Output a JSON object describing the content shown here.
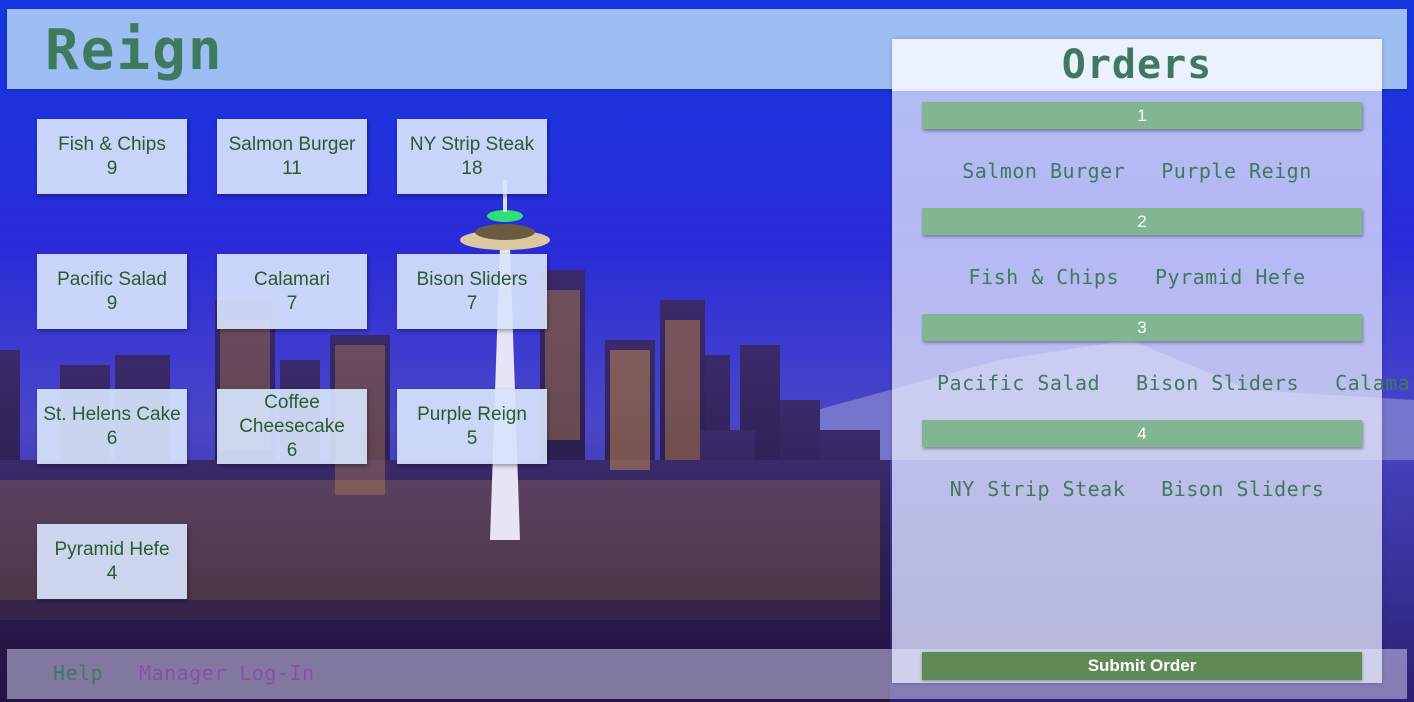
{
  "brand": {
    "title": "Reign",
    "color": "#3f7a5e"
  },
  "menu": {
    "items": [
      {
        "name": "Fish & Chips",
        "price": "9"
      },
      {
        "name": "Salmon Burger",
        "price": "11"
      },
      {
        "name": "NY Strip Steak",
        "price": "18"
      },
      {
        "name": "Pacific Salad",
        "price": "9"
      },
      {
        "name": "Calamari",
        "price": "7"
      },
      {
        "name": "Bison Sliders",
        "price": "7"
      },
      {
        "name": "St. Helens Cake",
        "price": "6"
      },
      {
        "name": "Coffee Cheesecake",
        "price": "6"
      },
      {
        "name": "Purple Reign",
        "price": "5"
      },
      {
        "name": "Pyramid Hefe",
        "price": "4"
      }
    ]
  },
  "orders": {
    "title": "Orders",
    "list": [
      {
        "number": "1",
        "items": [
          "Salmon Burger",
          "Purple Reign"
        ]
      },
      {
        "number": "2",
        "items": [
          "Fish & Chips",
          "Pyramid Hefe"
        ]
      },
      {
        "number": "3",
        "items": [
          "Pacific Salad",
          "Bison Sliders",
          "Calamari"
        ]
      },
      {
        "number": "4",
        "items": [
          "NY Strip Steak",
          "Bison Sliders"
        ]
      }
    ],
    "submit_label": "Submit Order",
    "bar_color": "#82b591",
    "submit_color": "#5f8a56"
  },
  "footer": {
    "help_label": "Help",
    "manager_label": "Manager Log-In",
    "help_color": "#3f7a5e",
    "manager_color": "#8a4fa8"
  }
}
